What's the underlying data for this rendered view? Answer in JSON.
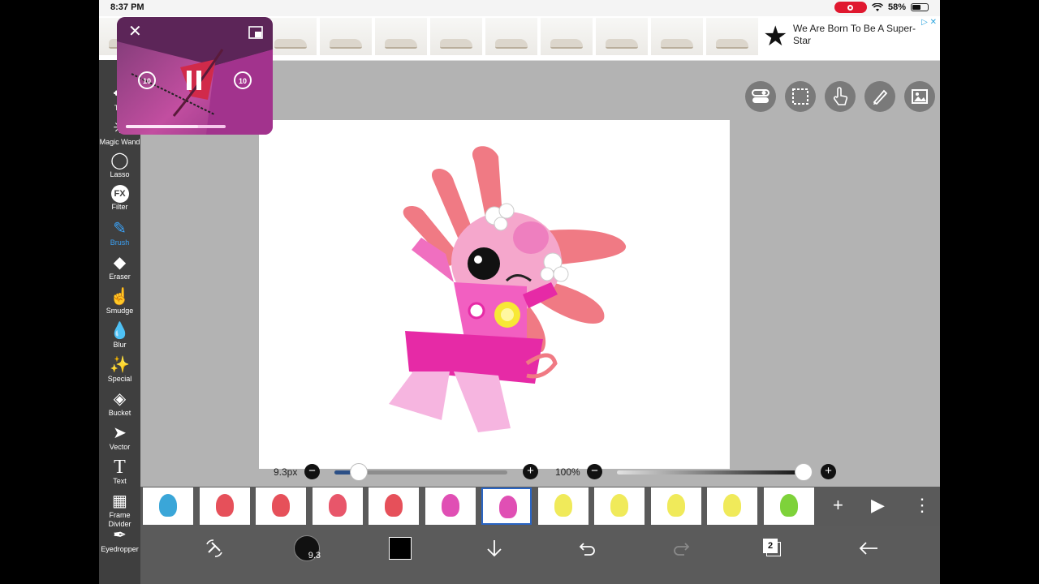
{
  "status_bar": {
    "time": "8:37 PM",
    "battery": "58%"
  },
  "ad": {
    "headline": "We Are Born To Be A Super-Star",
    "ad_choices": "▷ ✕",
    "thumb_count": 12
  },
  "pip": {
    "rewind_label": "10",
    "forward_label": "10",
    "progress_fraction": 0.72
  },
  "left_toolbar": {
    "items": [
      {
        "label": "Tra",
        "icon": "move-icon"
      },
      {
        "label": "Magic Wand",
        "icon": "magic-wand-icon"
      },
      {
        "label": "Lasso",
        "icon": "lasso-icon"
      },
      {
        "label": "Filter",
        "icon": "fx-icon",
        "glyph": "FX"
      },
      {
        "label": "Brush",
        "icon": "brush-icon",
        "active": true
      },
      {
        "label": "Eraser",
        "icon": "eraser-icon"
      },
      {
        "label": "Smudge",
        "icon": "smudge-icon"
      },
      {
        "label": "Blur",
        "icon": "blur-drop-icon"
      },
      {
        "label": "Special",
        "icon": "sparkle-icon"
      },
      {
        "label": "Bucket",
        "icon": "bucket-icon"
      },
      {
        "label": "Vector",
        "icon": "vector-arrow-icon"
      },
      {
        "label": "Text",
        "icon": "text-icon",
        "glyph": "T"
      },
      {
        "label": "Frame Divider",
        "icon": "frame-divider-icon"
      },
      {
        "label": "Eyedropper",
        "icon": "eyedropper-icon"
      }
    ]
  },
  "top_right_tools": [
    {
      "icon": "toggle-settings-icon"
    },
    {
      "icon": "selection-icon"
    },
    {
      "icon": "hand-touch-icon"
    },
    {
      "icon": "ruler-pen-icon"
    },
    {
      "icon": "image-layer-icon"
    }
  ],
  "brush_size": {
    "label": "9.3px",
    "value_fraction": 0.14
  },
  "opacity": {
    "label": "100%",
    "value_fraction": 1.0
  },
  "timeline": {
    "frame_count": 12,
    "active_frame_index": 6,
    "add_label": "+",
    "play_label": "▶",
    "more_label": "⋮"
  },
  "bottom_bar": {
    "brush_size_badge": "9.3",
    "color_swatch": "#000000",
    "layer_count": "2"
  },
  "colors": {
    "toolbar_bg": "#3f3f3f",
    "accent": "#3ba1f5",
    "frame_selection": "#2a65c4",
    "record_red": "#e0182f"
  }
}
